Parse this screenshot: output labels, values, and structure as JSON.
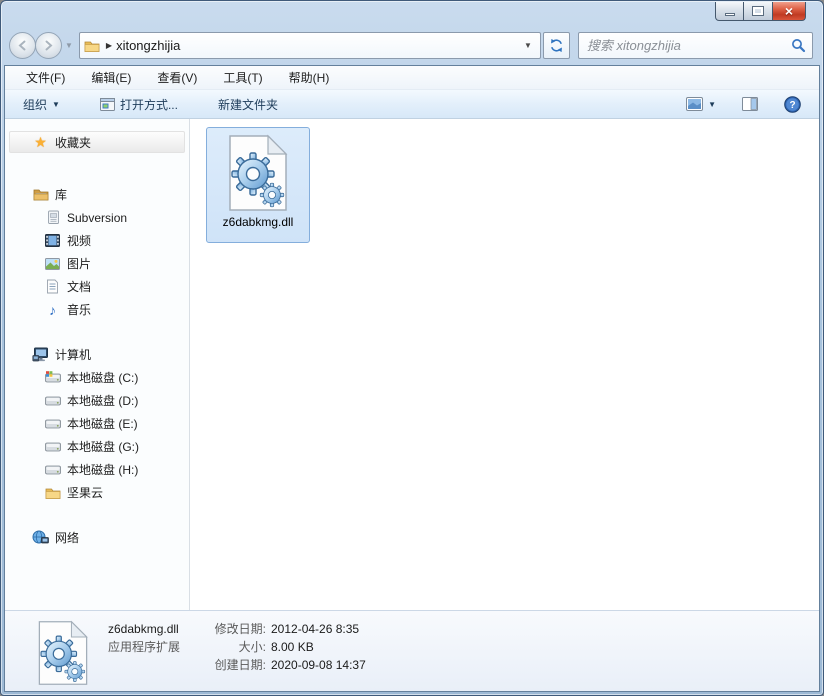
{
  "window": {
    "controls": {
      "close_glyph": "×"
    }
  },
  "navbar": {
    "address_path": "xitongzhijia",
    "search_placeholder": "搜索 xitongzhijia"
  },
  "menubar": {
    "items": [
      "文件(F)",
      "编辑(E)",
      "查看(V)",
      "工具(T)",
      "帮助(H)"
    ]
  },
  "toolbar": {
    "organize": "组织",
    "open_with": "打开方式...",
    "new_folder": "新建文件夹",
    "help_glyph": "?"
  },
  "sidebar": {
    "sections": [
      {
        "label": "收藏夹"
      },
      {
        "label": "库",
        "children": [
          "Subversion",
          "视频",
          "图片",
          "文档",
          "音乐"
        ]
      },
      {
        "label": "计算机",
        "children": [
          "本地磁盘 (C:)",
          "本地磁盘 (D:)",
          "本地磁盘 (E:)",
          "本地磁盘 (G:)",
          "本地磁盘 (H:)",
          "坚果云"
        ]
      },
      {
        "label": "网络"
      }
    ]
  },
  "files": [
    {
      "name": "z6dabkmg.dll"
    }
  ],
  "details": {
    "name": "z6dabkmg.dll",
    "type": "应用程序扩展",
    "rows": [
      {
        "label": "修改日期:",
        "value": "2012-04-26 8:35"
      },
      {
        "label": "大小:",
        "value": "8.00 KB"
      },
      {
        "label": "创建日期:",
        "value": "2020-09-08 14:37"
      }
    ]
  },
  "icons": {
    "star": "★",
    "dropdown": "▼",
    "breadcrumb_arrow": "▶",
    "music_note": "♪"
  },
  "colors": {
    "glass_blue": "#a9c4de",
    "close_red": "#c03a22",
    "selection_border": "#84aedc",
    "selection_fill": "#d6e7f9",
    "toolbar_text": "#1e3c5a"
  }
}
